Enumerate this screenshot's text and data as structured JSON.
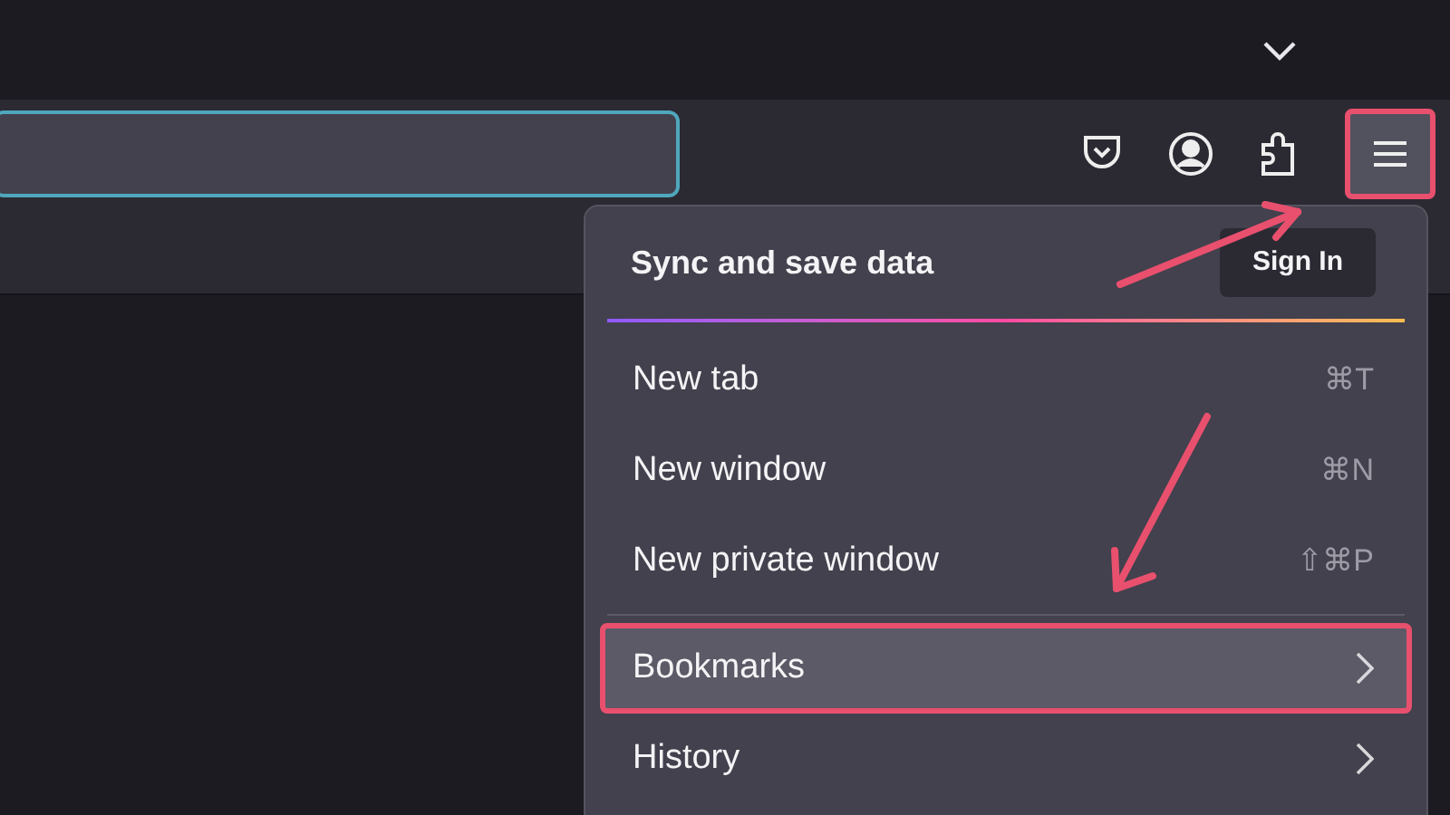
{
  "toolbar": {
    "menu_button": {
      "highlighted": true
    }
  },
  "menu": {
    "header": {
      "title": "Sync and save data",
      "button": "Sign In"
    },
    "items": [
      {
        "kind": "shortcut",
        "label": "New tab",
        "shortcut": "⌘T",
        "highlighted": false
      },
      {
        "kind": "shortcut",
        "label": "New window",
        "shortcut": "⌘N",
        "highlighted": false
      },
      {
        "kind": "shortcut",
        "label": "New private window",
        "shortcut": "⇧⌘P",
        "highlighted": false
      },
      {
        "kind": "separator"
      },
      {
        "kind": "submenu",
        "label": "Bookmarks",
        "highlighted": true
      },
      {
        "kind": "submenu",
        "label": "History",
        "highlighted": false
      }
    ]
  }
}
